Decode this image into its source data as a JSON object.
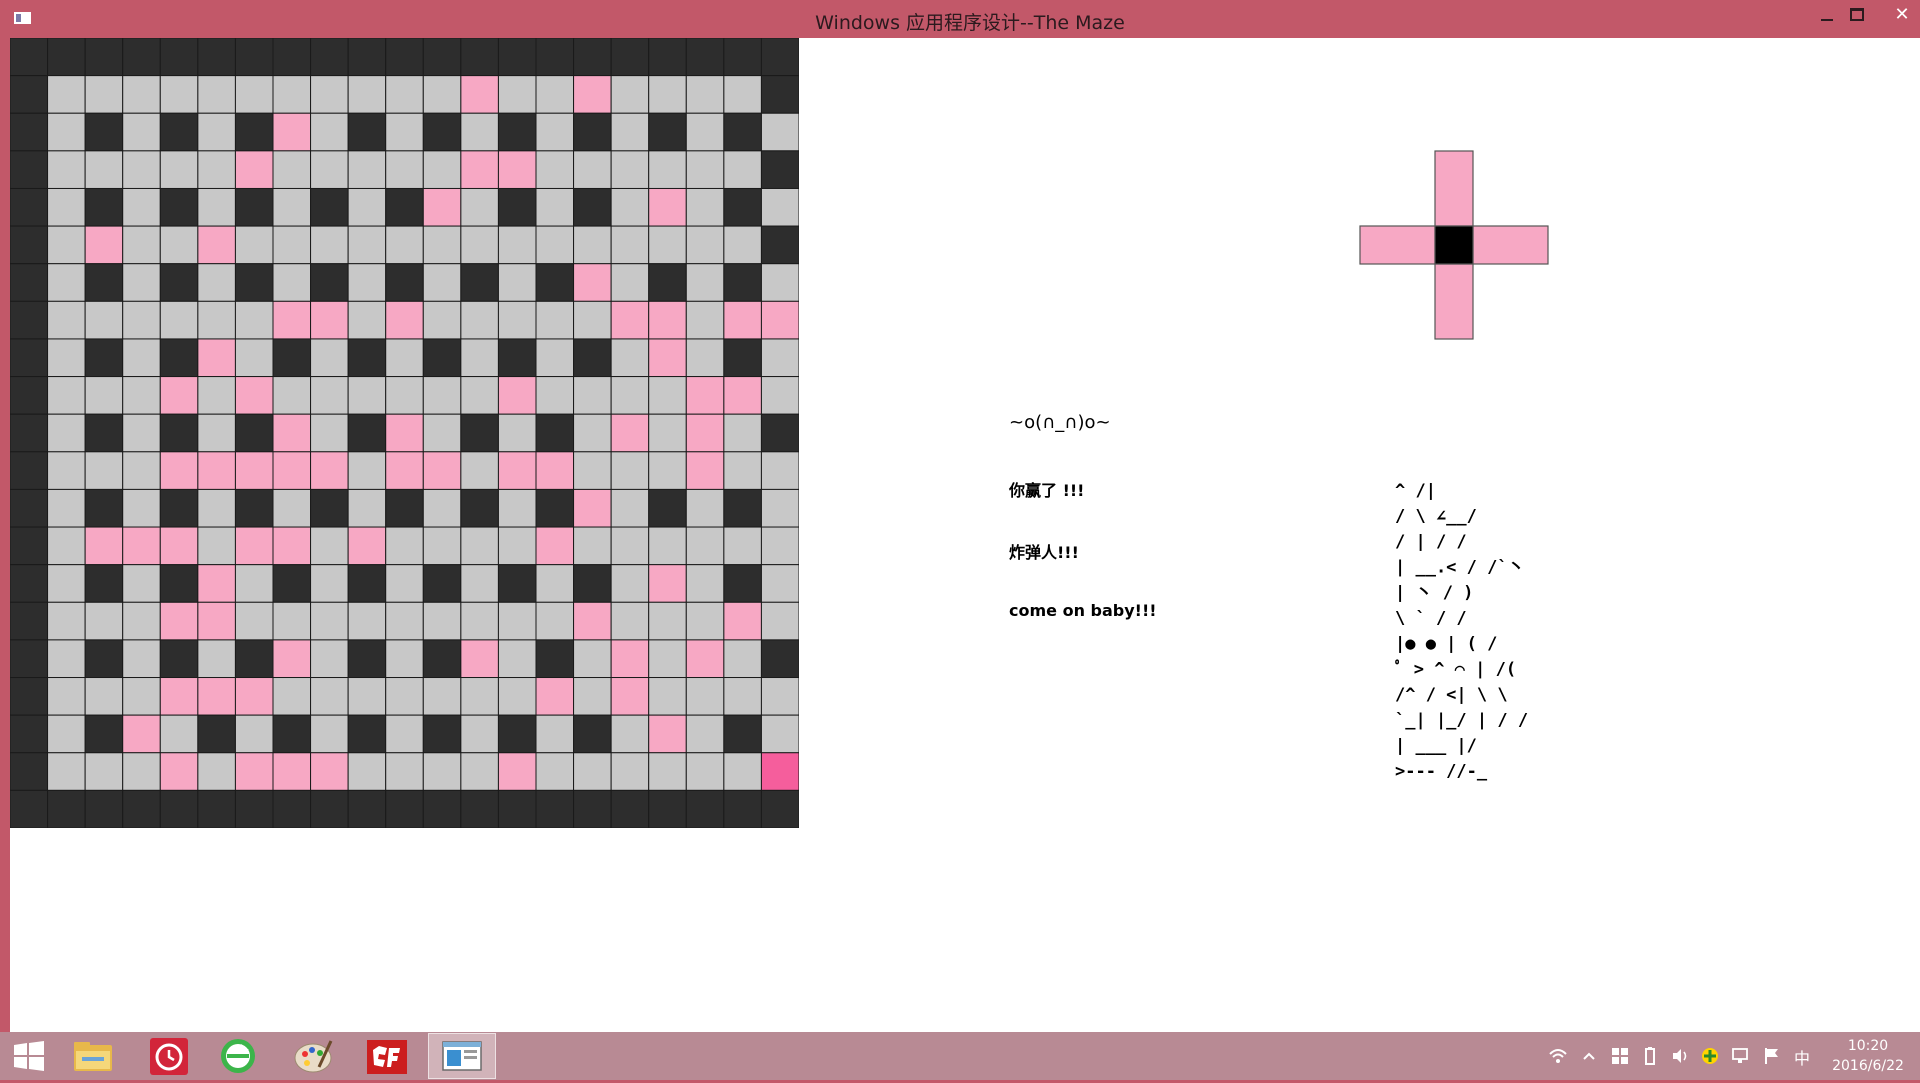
{
  "window": {
    "title": "Windows 应用程序设计--The Maze",
    "close_symbol": "✕"
  },
  "colors": {
    "window_frame": "#c25869",
    "wall": "#2d2d2d",
    "floor": "#c8c8c8",
    "flame": "#f7a8c4",
    "player": "#f55e9c",
    "bomb": "#000000",
    "taskbar": "#b88a94"
  },
  "maze": {
    "size": 21,
    "legend": {
      "W": "wall",
      ".": "floor",
      "p": "flame",
      "X": "player"
    },
    "rows": [
      "WWWWWWWWWWWWWWWWWWWWW",
      "W...........p..p....W",
      "W.W.W.Wp.W.W.W.W.W.W",
      "W.....p.....pp......W",
      "W.W.W.W.W.Wp.W.W.p.W",
      "W.p..p..............W",
      "W.W.W.W.W.W.W.Wp.W.W",
      "W......pp.p.....pp.ppW",
      "W.W.Wp.W.W.W.W.W.p.W",
      "W...p.p......p....pp.W",
      "W.W.W.Wp.Wp.W.W.p.p.W",
      "W...ppppp.pp.pp...p..W",
      "W.W.W.W.W.W.W.Wp.W.W",
      "W.ppp.pp.p....p......W",
      "W.W.Wp.W.W.W.W.W.p.W",
      "W...pp.........p...p.W",
      "W.W.W.Wp.W.Wp.W.p.p.W",
      "W...ppp.......p.p....W",
      "W.Wp.W.W.W.W.W.W.p.W",
      "W...p.ppp....p......XW",
      "WWWWWWWWWWWWWWWWWWWWW"
    ]
  },
  "messages": {
    "emote": "~o(∩_∩)o~",
    "win": "你赢了 !!!",
    "bomber": "炸弹人!!!",
    "come_on": "come on baby!!!"
  },
  "ascii_art": {
    "lines": [
      "  ^          /|",
      " / \\       ∠__/",
      " /  |       /   /",
      "|    __.<   /    /`丶",
      "|         丶   /     )",
      "\\          `  /   /",
      "|●    ●     | (   /",
      "ﾟ >  ^   ⌒  |  /(",
      "/^     /   <| \\ \\",
      " `_|    |_/   | / /",
      "  |     ___    |/",
      "  >---   //-_"
    ]
  },
  "taskbar": {
    "time": "10:20",
    "date": "2016/6/22",
    "ime": "中",
    "apps": [
      "windows-start",
      "file-explorer",
      "alarm-clock",
      "ie-browser",
      "paint",
      "cf-app",
      "maze-app"
    ]
  }
}
